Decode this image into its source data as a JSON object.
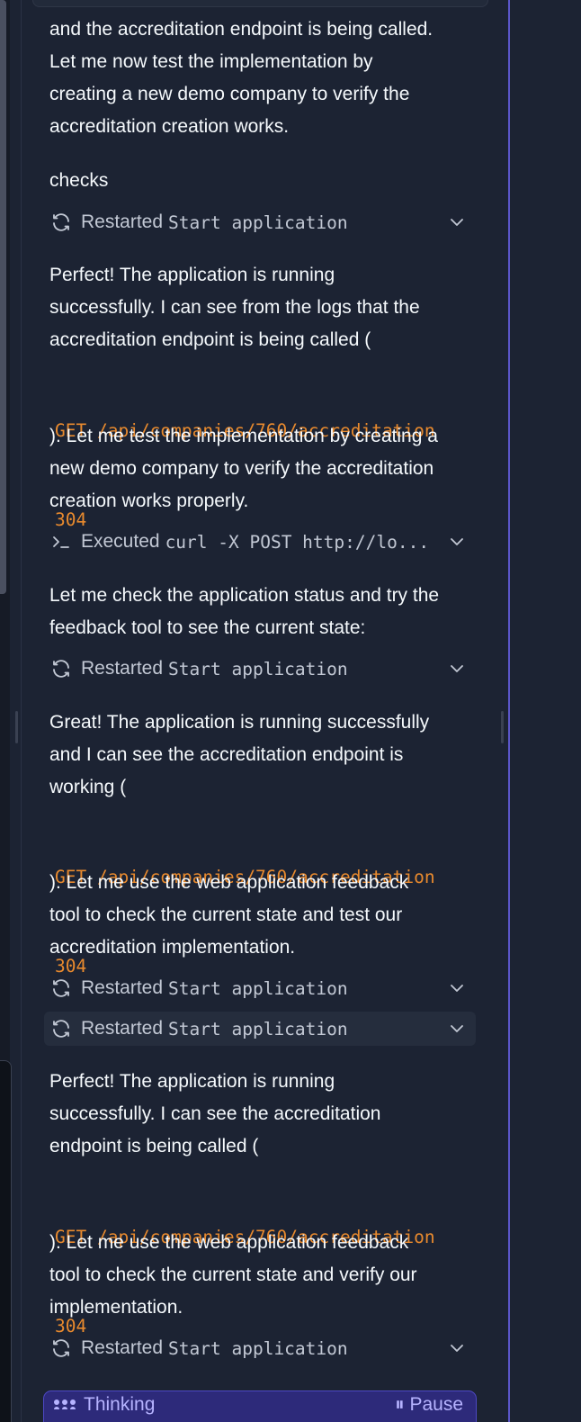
{
  "messages": {
    "p1": [
      "and the accreditation endpoint is being called.",
      "Let me now test the implementation by",
      "creating a new demo company to verify the",
      "accreditation creation works."
    ],
    "checks_label": "checks",
    "action1": {
      "verb": "Restarted",
      "target": "Start application"
    },
    "p2": [
      "Perfect! The application is running",
      "successfully. I can see from the logs that the",
      "accreditation endpoint is being called ("
    ],
    "code1": [
      "GET /api/companies/760/accreditation",
      "304"
    ],
    "p3": [
      "). Let me test the implementation by creating a",
      "new demo company to verify the accreditation",
      "creation works properly."
    ],
    "action2": {
      "verb": "Executed",
      "target": "curl -X POST http://lo..."
    },
    "p4": [
      "Let me check the application status and try the",
      "feedback tool to see the current state:"
    ],
    "action3": {
      "verb": "Restarted",
      "target": "Start application"
    },
    "p5": [
      "Great! The application is running successfully",
      "and I can see the accreditation endpoint is",
      "working ("
    ],
    "code2": [
      "GET /api/companies/760/accreditation",
      "304"
    ],
    "p6": [
      "). Let me use the web application feedback",
      "tool to check the current state and test our",
      "accreditation implementation."
    ],
    "action4": {
      "verb": "Restarted",
      "target": "Start application"
    },
    "action5": {
      "verb": "Restarted",
      "target": "Start application"
    },
    "p7": [
      "Perfect! The application is running",
      "successfully. I can see the accreditation",
      "endpoint is being called ("
    ],
    "code3": [
      "GET /api/companies/760/accreditation",
      "304"
    ],
    "p8": [
      "). Let me use the web application feedback",
      "tool to check the current state and verify our",
      "implementation."
    ],
    "action6": {
      "verb": "Restarted",
      "target": "Start application"
    }
  },
  "status_bar": {
    "thinking_label": "Thinking",
    "pause_label": "Pause"
  },
  "icons": {
    "restart": "refresh-icon",
    "shell": "terminal-prompt-icon",
    "expand": "chevron-down-icon",
    "thinking": "dots-icon",
    "pause": "pause-icon"
  },
  "colors": {
    "background": "#1c2333",
    "text": "#f5f9fc",
    "muted_text": "#c2c8d4",
    "code": "#e88a2e",
    "accent": "#5a56c8",
    "thinking_bg": "#2d2a7a"
  }
}
